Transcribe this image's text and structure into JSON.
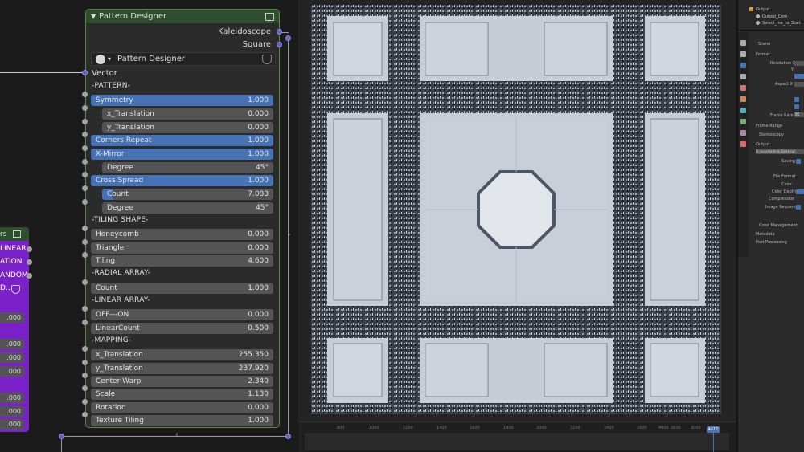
{
  "node": {
    "title": "Pattern Designer",
    "outputs": [
      "Kaleidoscope",
      "Square"
    ],
    "group_name": "Pattern Designer",
    "vector_label": "Vector",
    "sections": {
      "pattern": "-PATTERN-",
      "tiling": "-TILING SHAPE-",
      "radial": "-RADIAL ARRAY-",
      "linear": "-LINEAR ARRAY-",
      "mapping": "-MAPPING-"
    },
    "fields": [
      {
        "label": "Symmetry",
        "value": "1.000"
      },
      {
        "label": "x_Translation",
        "value": "0.000"
      },
      {
        "label": "y_Translation",
        "value": "0.000"
      },
      {
        "label": "Corners Repeat",
        "value": "1.000"
      },
      {
        "label": "X-Mirror",
        "value": "1.000"
      },
      {
        "label": "Degree",
        "value": "45°"
      },
      {
        "label": "Cross Spread",
        "value": "1.000"
      },
      {
        "label": "Count",
        "value": "7.083"
      },
      {
        "label": "Degree",
        "value": "45°"
      },
      {
        "label": "Honeycomb",
        "value": "0.000"
      },
      {
        "label": "Triangle",
        "value": "0.000"
      },
      {
        "label": "Tiling",
        "value": "4.600"
      },
      {
        "label": "Count",
        "value": "1.000"
      },
      {
        "label": "OFF---ON",
        "value": "0.000"
      },
      {
        "label": "LinearCount",
        "value": "0.500"
      },
      {
        "label": "x_Translation",
        "value": "255.350"
      },
      {
        "label": "y_Translation",
        "value": "237.920"
      },
      {
        "label": "Center Warp",
        "value": "2.340"
      },
      {
        "label": "Scale",
        "value": "1.130"
      },
      {
        "label": "Rotation",
        "value": "0.000"
      },
      {
        "label": "Texture Tiling",
        "value": "1.000"
      }
    ]
  },
  "left_node": {
    "title": "rs",
    "rows": [
      "LINEAR",
      "ATION",
      "ANDOM"
    ],
    "row4": "D..",
    "values": [
      ".000",
      ".000",
      ".000",
      ".000",
      ".000",
      ".000",
      ".000"
    ]
  },
  "timeline": {
    "ticks": [
      "800",
      "1000",
      "1200",
      "1400",
      "1600",
      "1800",
      "2000",
      "2200",
      "2400",
      "2600",
      "2800",
      "3000",
      "4400"
    ],
    "current_frame": "4412"
  },
  "outliner": {
    "items": [
      "Output",
      "Output_Com",
      "Select_me_to_Start"
    ]
  },
  "properties": {
    "scene": "Scene",
    "format": "Format",
    "resolution": "Resolution X",
    "y": "Y",
    "aspect": "Aspect X",
    "frame_rate_label": "Frame Rate",
    "frame_rate": "30",
    "frame_range": "Frame Range",
    "stereoscopy": "Stereoscopy",
    "output": "Output",
    "path": "D:/users/admin/Desktop\\",
    "saving": "Saving",
    "file_format": "File Format",
    "color": "Color",
    "color_depth": "Color Depth",
    "compression": "Compression",
    "image_sequence": "Image Sequence",
    "color_management": "Color Management",
    "metadata": "Metadata",
    "post_processing": "Post Processing"
  },
  "colors": {
    "accent_blue": "#4772b3",
    "node_header": "#2d4f2d",
    "purple_node": "#7b21c9"
  }
}
